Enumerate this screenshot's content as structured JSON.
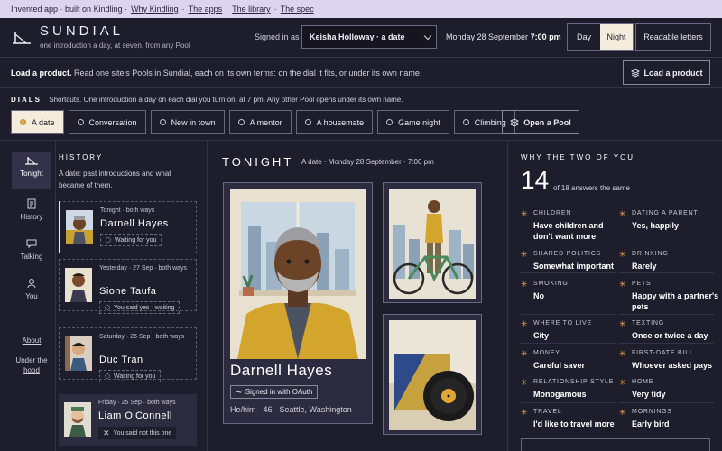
{
  "topbar": {
    "intro": "Invented app · built on Kindling ·",
    "links": [
      "Why Kindling",
      "The apps",
      "The library",
      "The spec"
    ],
    "sep": "·"
  },
  "header": {
    "brand": "SUNDIAL",
    "tagline": "one introduction a day, at seven, from any Pool",
    "signed_in_label": "Signed in as",
    "signed_in_value": "Keisha Holloway · a date",
    "date": "Monday 28 September",
    "time": "7:00 pm",
    "mode_day": "Day",
    "mode_night": "Night",
    "readable": "Readable letters"
  },
  "load": {
    "bold": "Load a product.",
    "text": "Read one site's Pools in Sundial, each on its own terms: on the dial it fits, or under its own name.",
    "button": "Load a product"
  },
  "dials": {
    "label": "DIALS",
    "desc": "Shortcuts. One introduction a day on each dial you turn on, at 7 pm. Any other Pool opens under its own name.",
    "tabs": [
      "A date",
      "Conversation",
      "New in town",
      "A mentor",
      "A housemate",
      "Game night",
      "Climbing"
    ],
    "open_pool": "Open a Pool"
  },
  "nav": {
    "items": [
      "Tonight",
      "History",
      "Talking",
      "You"
    ],
    "links": [
      "About",
      "Under the hood"
    ]
  },
  "history": {
    "title": "HISTORY",
    "desc": "A date: past introductions and what became of them.",
    "cards": [
      {
        "meta": "Tonight · both ways",
        "name": "Darnell Hayes",
        "status": "Waiting for you"
      },
      {
        "meta": "Yesterday · 27 Sep · both ways",
        "name": "Sione Taufa",
        "status": "You said yes · waiting"
      },
      {
        "meta": "Saturday · 26 Sep · both ways",
        "name": "Duc Tran",
        "status": "Waiting for you"
      },
      {
        "meta": "Friday · 25 Sep · both ways",
        "name": "Liam O'Connell",
        "status": "You said not this one"
      }
    ]
  },
  "tonight": {
    "title": "TONIGHT",
    "sub": "A date · Monday 28 September · 7:00 pm",
    "name": "Darnell Hayes",
    "badge": "Signed in with OAuth",
    "info": "He/him · 46 · Seattle, Washington"
  },
  "why": {
    "title": "WHY THE TWO OF YOU",
    "count": "14",
    "of": "of 18 answers the same",
    "items": [
      {
        "label": "CHILDREN",
        "value": "Have children and don't want more"
      },
      {
        "label": "DATING A PARENT",
        "value": "Yes, happily"
      },
      {
        "label": "SHARED POLITICS",
        "value": "Somewhat important"
      },
      {
        "label": "DRINKING",
        "value": "Rarely"
      },
      {
        "label": "SMOKING",
        "value": "No"
      },
      {
        "label": "PETS",
        "value": "Happy with a partner's pets"
      },
      {
        "label": "WHERE TO LIVE",
        "value": "City"
      },
      {
        "label": "TEXTING",
        "value": "Once or twice a day"
      },
      {
        "label": "MONEY",
        "value": "Careful saver"
      },
      {
        "label": "FIRST-DATE BILL",
        "value": "Whoever asked pays"
      },
      {
        "label": "RELATIONSHIP STYLE",
        "value": "Monogamous"
      },
      {
        "label": "HOME",
        "value": "Very tidy"
      },
      {
        "label": "TRAVEL",
        "value": "I'd like to travel more"
      },
      {
        "label": "MORNINGS",
        "value": "Early bird"
      }
    ]
  },
  "colors": {
    "accent": "#e8a84a",
    "bg": "#1e1d2b",
    "cream": "#f4ecdc"
  }
}
